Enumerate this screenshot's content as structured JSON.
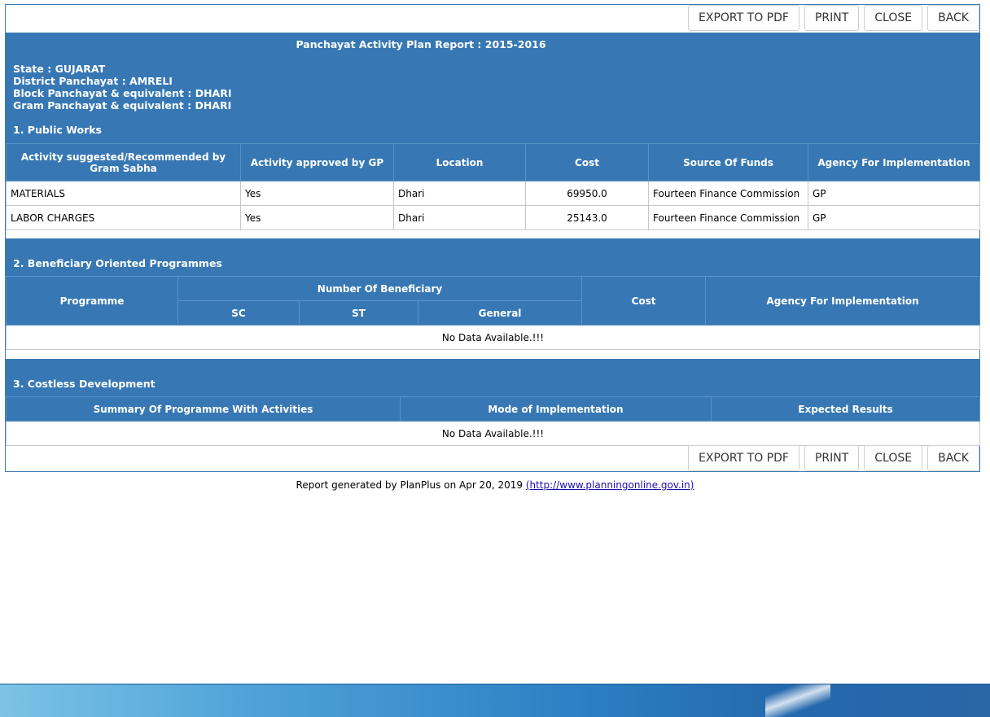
{
  "buttons": {
    "export_pdf": "EXPORT TO PDF",
    "print": "PRINT",
    "close": "CLOSE",
    "back": "BACK"
  },
  "report": {
    "title": "Panchayat Activity Plan Report : 2015-2016",
    "state": "State : GUJARAT",
    "district": "District Panchayat : AMRELI",
    "block": "Block Panchayat & equivalent : DHARI",
    "gram": "Gram Panchayat & equivalent : DHARI"
  },
  "public_works": {
    "title": "1. Public Works",
    "headers": [
      "Activity suggested/Recommended by Gram Sabha",
      "Activity approved by GP",
      "Location",
      "Cost",
      "Source Of Funds",
      "Agency For Implementation"
    ],
    "rows": [
      [
        "MATERIALS",
        "Yes",
        "Dhari",
        "69950.0",
        "Fourteen Finance Commission",
        "GP"
      ],
      [
        "LABOR CHARGES",
        "Yes",
        "Dhari",
        "25143.0",
        "Fourteen Finance Commission",
        "GP"
      ]
    ]
  },
  "beneficiary": {
    "title": "2. Beneficiary Oriented Programmes",
    "programme": "Programme",
    "number_of_beneficiary": "Number Of Beneficiary",
    "sc": "SC",
    "st": "ST",
    "general": "General",
    "cost": "Cost",
    "agency": "Agency For Implementation",
    "no_data": "No Data Available.!!!"
  },
  "costless": {
    "title": "3. Costless Development",
    "headers": [
      "Summary Of Programme With Activities",
      "Mode of Implementation",
      "Expected Results"
    ],
    "no_data": "No Data Available.!!!"
  },
  "footer": {
    "text": "Report generated by PlanPlus on Apr 20, 2019 ",
    "link": "(http://www.planningonline.gov.in)"
  }
}
